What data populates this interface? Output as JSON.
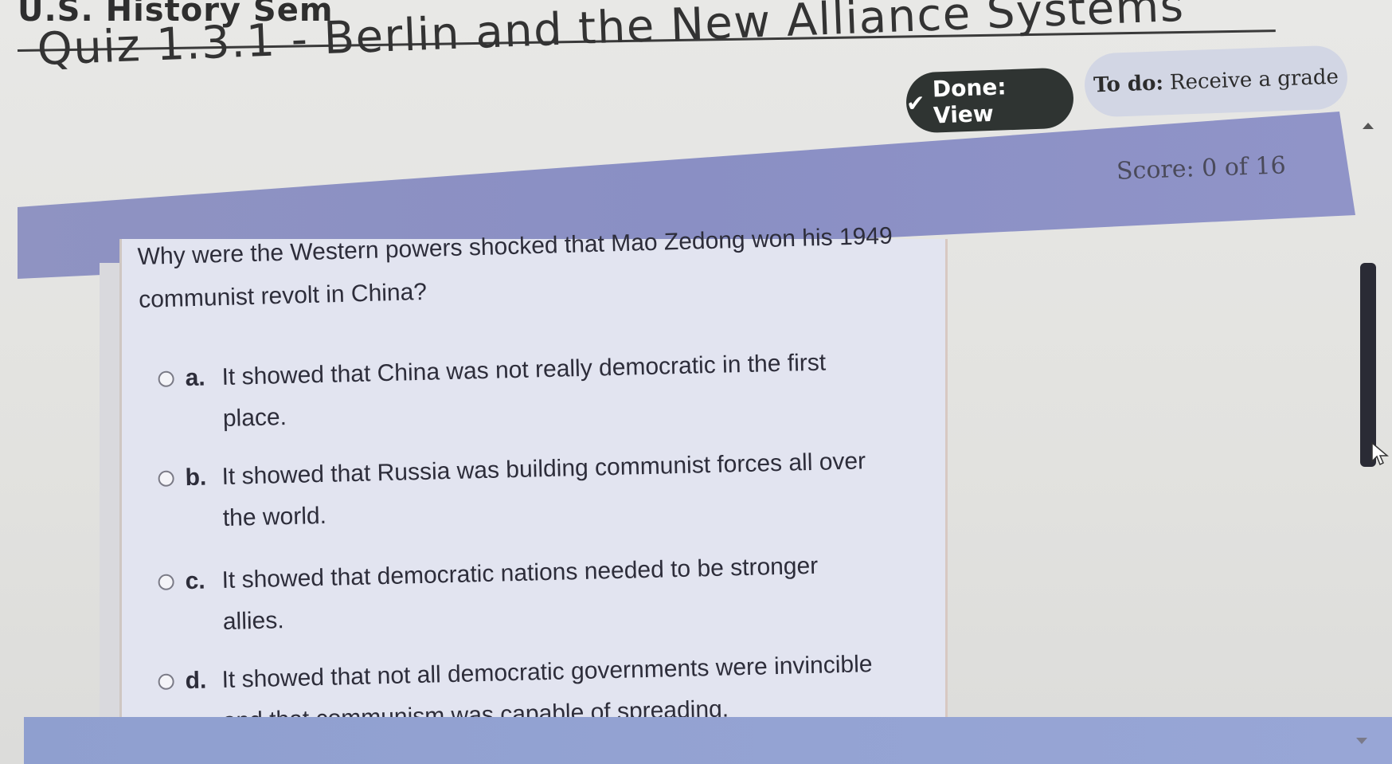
{
  "header": {
    "course_title": "U.S. History Sem",
    "quiz_title": "Quiz 1.3.1 - Berlin and the New Alliance Systems"
  },
  "status": {
    "done_label": "Done: View",
    "todo_prefix": "To do:",
    "todo_text": "Receive a grade",
    "score_text": "Score: 0 of 16"
  },
  "question": {
    "text": "Why were the Western powers shocked that Mao Zedong won his 1949 communist revolt in China?",
    "options": [
      {
        "letter": "a.",
        "text": "It showed that China was not really democratic in the first place."
      },
      {
        "letter": "b.",
        "text": "It showed that Russia was building communist forces all over the world."
      },
      {
        "letter": "c.",
        "text": "It showed that democratic nations needed to be stronger allies."
      },
      {
        "letter": "d.",
        "text": "It showed that not all democratic governments were invincible and that communism was capable of spreading."
      }
    ]
  },
  "icons": {
    "done": "check-icon",
    "scroll_up": "chevron-up-icon",
    "scroll_down": "chevron-down-icon",
    "cursor": "pointer-cursor-icon"
  },
  "colors": {
    "accent_band": "#8a8fc4",
    "done_pill": "#2f3432",
    "todo_pill": "#d2d6e4",
    "card_bg": "#e2e4f0"
  }
}
